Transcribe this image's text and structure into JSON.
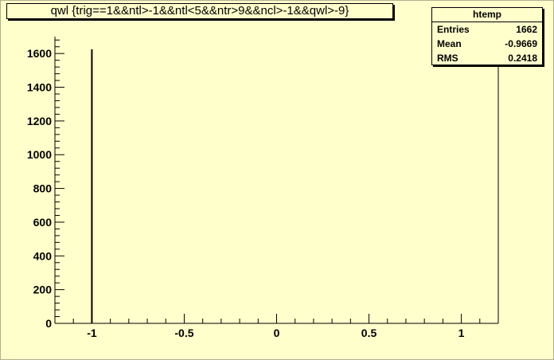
{
  "chart_data": {
    "type": "bar",
    "title": "qwl {trig==1&&ntl>-1&&ntl<5&&ntr>9&&ncl>-1&&qwl>-9}",
    "xlabel": "",
    "ylabel": "",
    "xlim": [
      -1.2,
      1.2
    ],
    "ylim": [
      0,
      1700
    ],
    "x_ticks": [
      -1,
      -0.5,
      0,
      0.5,
      1
    ],
    "x_tick_labels": [
      "-1",
      "-0.5",
      "0",
      "0.5",
      "1"
    ],
    "y_ticks": [
      0,
      200,
      400,
      600,
      800,
      1000,
      1200,
      1400,
      1600
    ],
    "y_tick_labels": [
      "0",
      "200",
      "400",
      "600",
      "800",
      "1000",
      "1200",
      "1400",
      "1600"
    ],
    "x": [
      -1
    ],
    "values": [
      1625
    ],
    "grid": false
  },
  "stats": {
    "title": "htemp",
    "rows": [
      {
        "label": "Entries",
        "value": "1662"
      },
      {
        "label": "Mean",
        "value": "-0.9669"
      },
      {
        "label": "RMS",
        "value": "0.2418"
      }
    ]
  },
  "colors": {
    "background": "#ffffcc",
    "line": "#000000"
  }
}
